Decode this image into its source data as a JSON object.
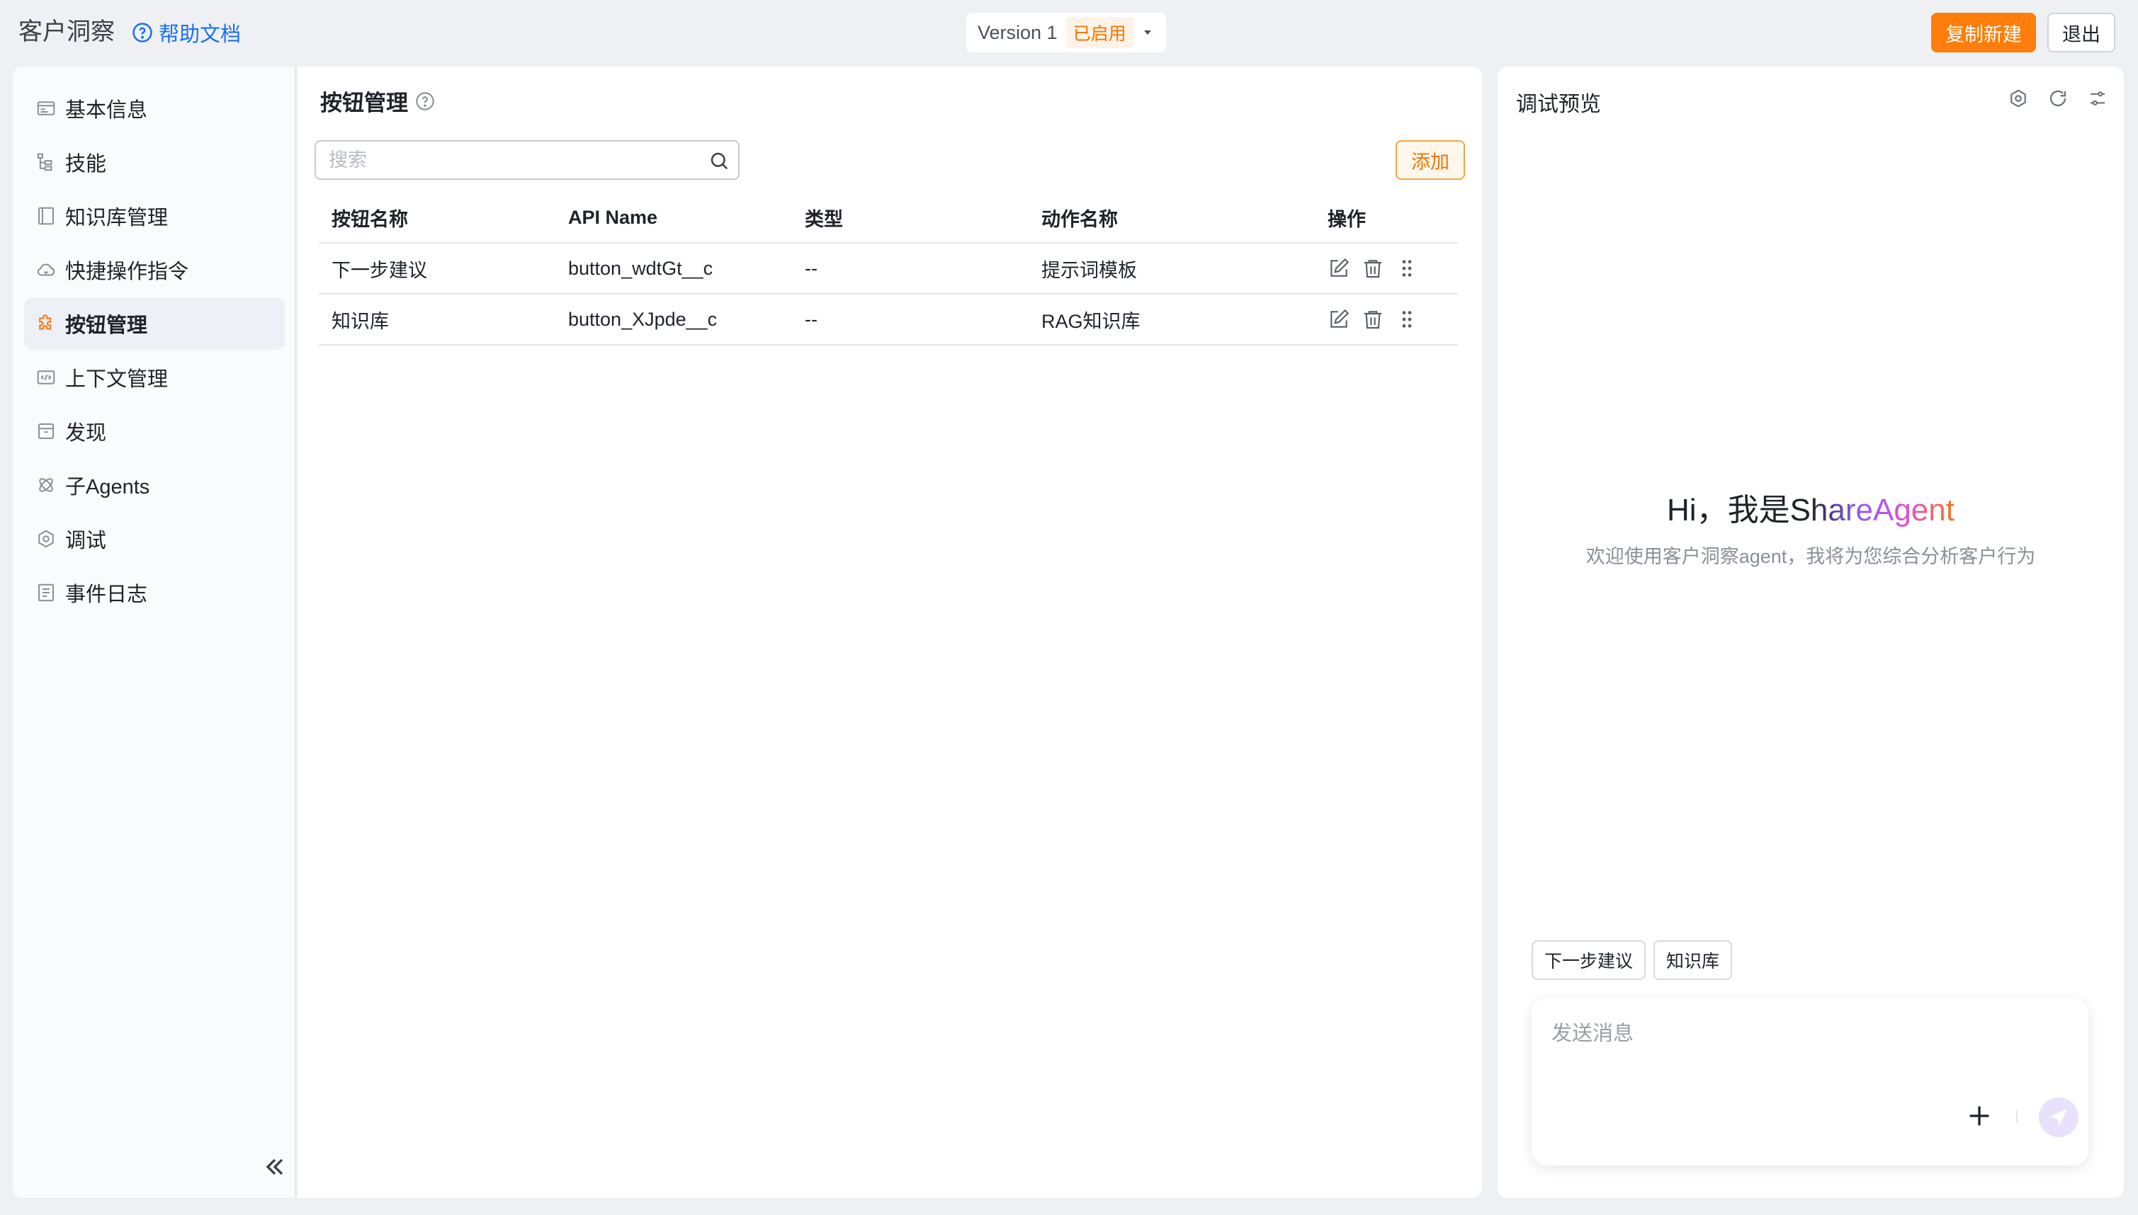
{
  "header": {
    "app_title": "客户洞察",
    "help_label": "帮助文档",
    "version_label": "Version 1",
    "version_status": "已启用",
    "copy_button": "复制新建",
    "exit_button": "退出"
  },
  "sidebar": {
    "items": [
      {
        "label": "基本信息",
        "icon": "info-card-icon"
      },
      {
        "label": "技能",
        "icon": "tree-icon"
      },
      {
        "label": "知识库管理",
        "icon": "book-icon"
      },
      {
        "label": "快捷操作指令",
        "icon": "cloud-icon"
      },
      {
        "label": "按钮管理",
        "icon": "puzzle-icon",
        "active": true
      },
      {
        "label": "上下文管理",
        "icon": "code-icon"
      },
      {
        "label": "发现",
        "icon": "box-icon"
      },
      {
        "label": "子Agents",
        "icon": "atom-icon"
      },
      {
        "label": "调试",
        "icon": "gear-icon"
      },
      {
        "label": "事件日志",
        "icon": "log-icon"
      }
    ]
  },
  "main": {
    "title": "按钮管理",
    "search_placeholder": "搜索",
    "add_button": "添加",
    "columns": [
      "按钮名称",
      "API Name",
      "类型",
      "动作名称",
      "操作"
    ],
    "rows": [
      {
        "name": "下一步建议",
        "api_name": "button_wdtGt__c",
        "type": "--",
        "action": "提示词模板"
      },
      {
        "name": "知识库",
        "api_name": "button_XJpde__c",
        "type": "--",
        "action": "RAG知识库"
      }
    ]
  },
  "debug": {
    "title": "调试预览",
    "greeting_prefix": "Hi，我是",
    "greeting_brand": "ShareAgent",
    "greeting_sub": "欢迎使用客户洞察agent，我将为您综合分析客户行为",
    "quick_buttons": [
      "下一步建议",
      "知识库"
    ],
    "input_placeholder": "发送消息"
  },
  "colors": {
    "accent": "#ff7d0a",
    "link": "#1b6ff0",
    "status_text": "#f27300"
  }
}
